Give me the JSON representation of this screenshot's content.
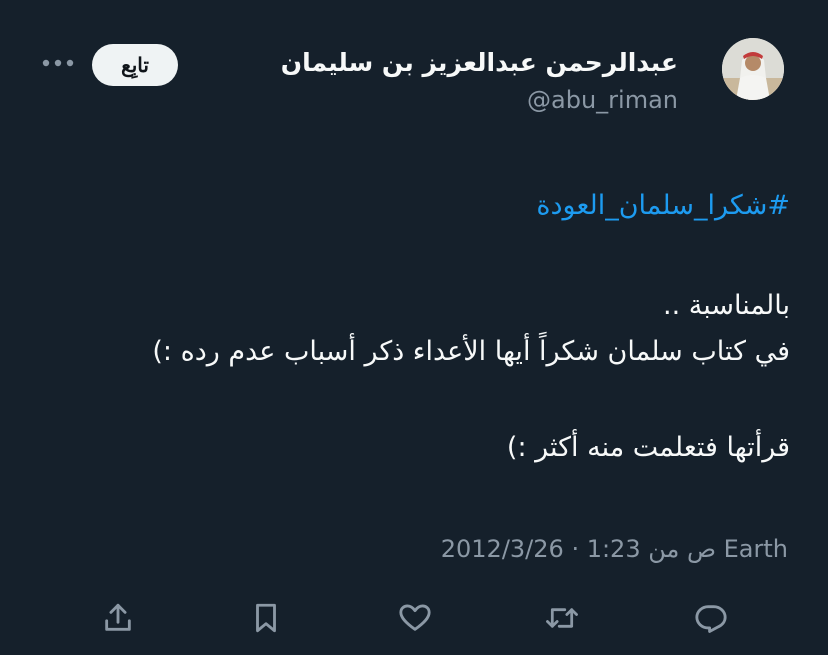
{
  "author": {
    "display_name": "عبدالرحمن عبدالعزيز بن سليمان",
    "handle": "@abu_riman"
  },
  "follow_button": {
    "label": "تابِع"
  },
  "tweet": {
    "hashtag": "#شكرا_سلمان_العودة",
    "lines": [
      "بالمناسبة ..",
      "في كتاب سلمان شكراً أيها الأعداء ذكر أسباب عدم رده :)",
      "قرأتها فتعلمت منه أكثر :)"
    ],
    "timestamp": "2012/3/26 · 1:23 ص من Earth"
  },
  "icons": {
    "more": "more-horizontal-icon",
    "share": "share-icon",
    "bookmark": "bookmark-icon",
    "like": "heart-icon",
    "retweet": "retweet-icon",
    "reply": "reply-icon"
  },
  "colors": {
    "background": "#15202b",
    "text": "#f7f9f9",
    "muted": "#8b98a5",
    "link": "#1d9bf0",
    "button_bg": "#eff3f4"
  }
}
